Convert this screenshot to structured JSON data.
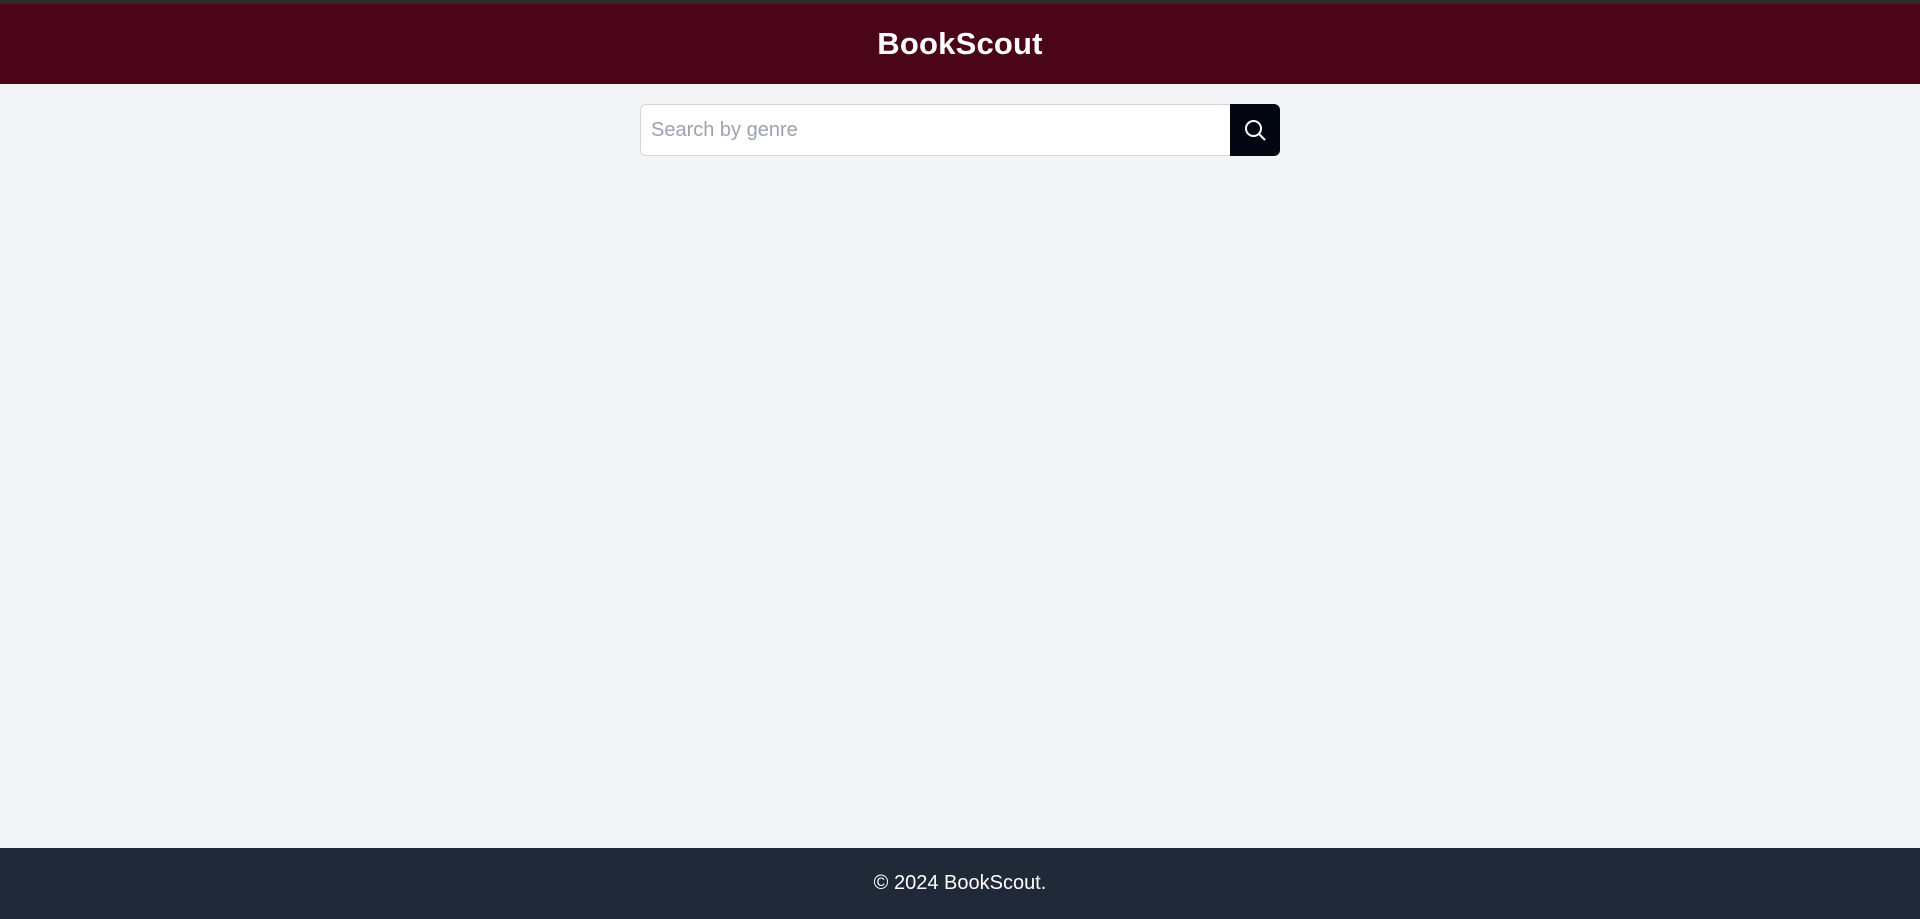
{
  "header": {
    "title": "BookScout"
  },
  "search": {
    "placeholder": "Search by genre",
    "value": "",
    "button_icon": "search-icon"
  },
  "footer": {
    "copyright": "© 2024 BookScout."
  },
  "colors": {
    "header_bg": "#4a0519",
    "page_bg": "#f3f4f6",
    "search_button_bg": "#030712",
    "footer_bg": "#1f2937"
  }
}
